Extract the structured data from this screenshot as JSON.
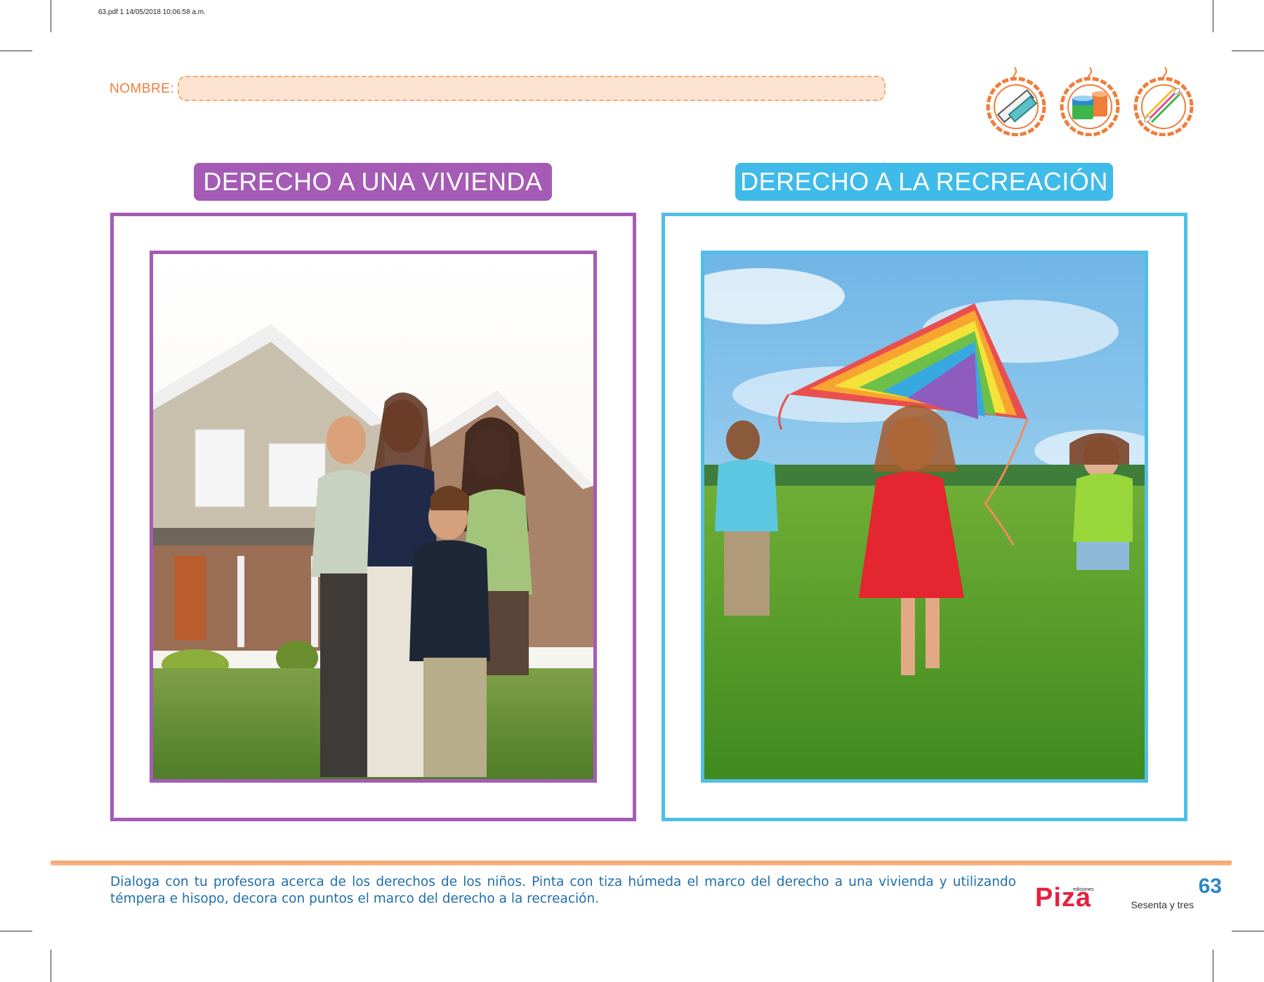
{
  "print_info": "63.pdf   1   14/05/2018   10:06:58 a.m.",
  "header": {
    "name_label": "NOMBRE:",
    "materials": [
      {
        "icon": "chalk-icon"
      },
      {
        "icon": "tempera-paint-icon"
      },
      {
        "icon": "cotton-swab-icon"
      }
    ]
  },
  "panels": [
    {
      "title": "DERECHO A UNA VIVIENDA",
      "color": "#a55bb5",
      "image": "family-in-front-of-house-photo"
    },
    {
      "title": "DERECHO A LA RECREACIÓN",
      "color": "#4fbfe8",
      "image": "children-flying-kite-photo"
    }
  ],
  "footer": {
    "instructions": "Dialoga con tu profesora acerca de los derechos de los niños. Pinta con tiza húmeda el marco del derecho a una vivienda y utilizando témpera e hisopo, decora con puntos el marco del derecho a la recreación.",
    "logo_small": "ediciones",
    "logo_word": "Piza",
    "page_number": "63",
    "page_number_words": "Sesenta y tres"
  },
  "colors": {
    "accent_orange": "#f07d3a",
    "purple": "#a55bb5",
    "blue": "#4fbfe8",
    "instruction_blue": "#1f6ea8",
    "logo_red": "#e5213e"
  }
}
